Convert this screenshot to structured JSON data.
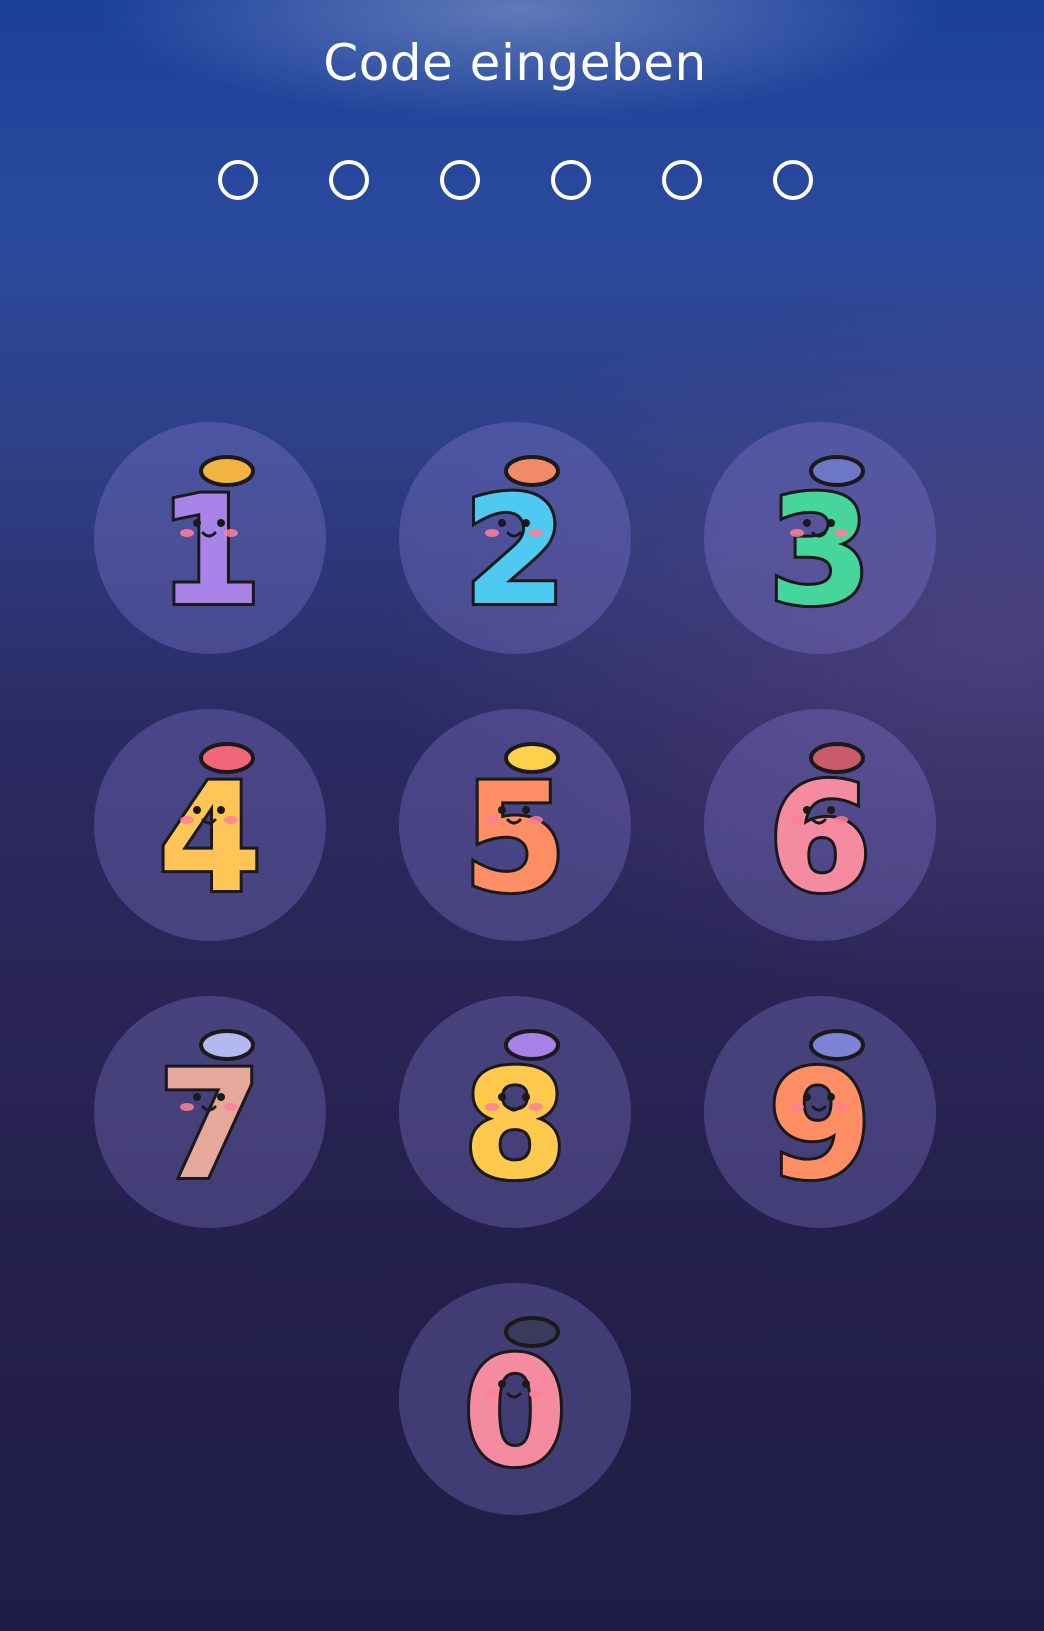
{
  "header": {
    "title": "Code eingeben"
  },
  "code_indicator": {
    "length": 6,
    "filled": 0
  },
  "keypad": {
    "keys": [
      {
        "digit": "1",
        "icon": "cartoon-one-icon",
        "color": "#a884e8",
        "color_dark": "#8a62d6",
        "accessory": "#f2b340"
      },
      {
        "digit": "2",
        "icon": "cartoon-two-icon",
        "color": "#4ec9f2",
        "color_dark": "#2aa8e0",
        "accessory": "#f28a68"
      },
      {
        "digit": "3",
        "icon": "cartoon-three-icon",
        "color": "#46d69c",
        "color_dark": "#1fb47a",
        "accessory": "#6e78c8"
      },
      {
        "digit": "4",
        "icon": "cartoon-four-icon",
        "color": "#ffc557",
        "color_dark": "#f5a93a",
        "accessory": "#f2667a"
      },
      {
        "digit": "5",
        "icon": "cartoon-five-icon",
        "color": "#ff8e64",
        "color_dark": "#f26a4a",
        "accessory": "#ffd04a"
      },
      {
        "digit": "6",
        "icon": "cartoon-six-icon",
        "color": "#f58ba0",
        "color_dark": "#e9607a",
        "accessory": "#c85a6a"
      },
      {
        "digit": "7",
        "icon": "cartoon-seven-icon",
        "color": "#e6a89a",
        "color_dark": "#cf8a80",
        "accessory": "#b4b8f0"
      },
      {
        "digit": "8",
        "icon": "cartoon-eight-icon",
        "color": "#ffc94e",
        "color_dark": "#f5ab30",
        "accessory": "#a882e6"
      },
      {
        "digit": "9",
        "icon": "cartoon-nine-icon",
        "color": "#ff8e64",
        "color_dark": "#f26a4a",
        "accessory": "#7d84d6"
      },
      {
        "digit": "0",
        "icon": "cartoon-zero-icon",
        "color": "#f58ba0",
        "color_dark": "#e9607a",
        "accessory": "#3a3a5a"
      }
    ]
  }
}
